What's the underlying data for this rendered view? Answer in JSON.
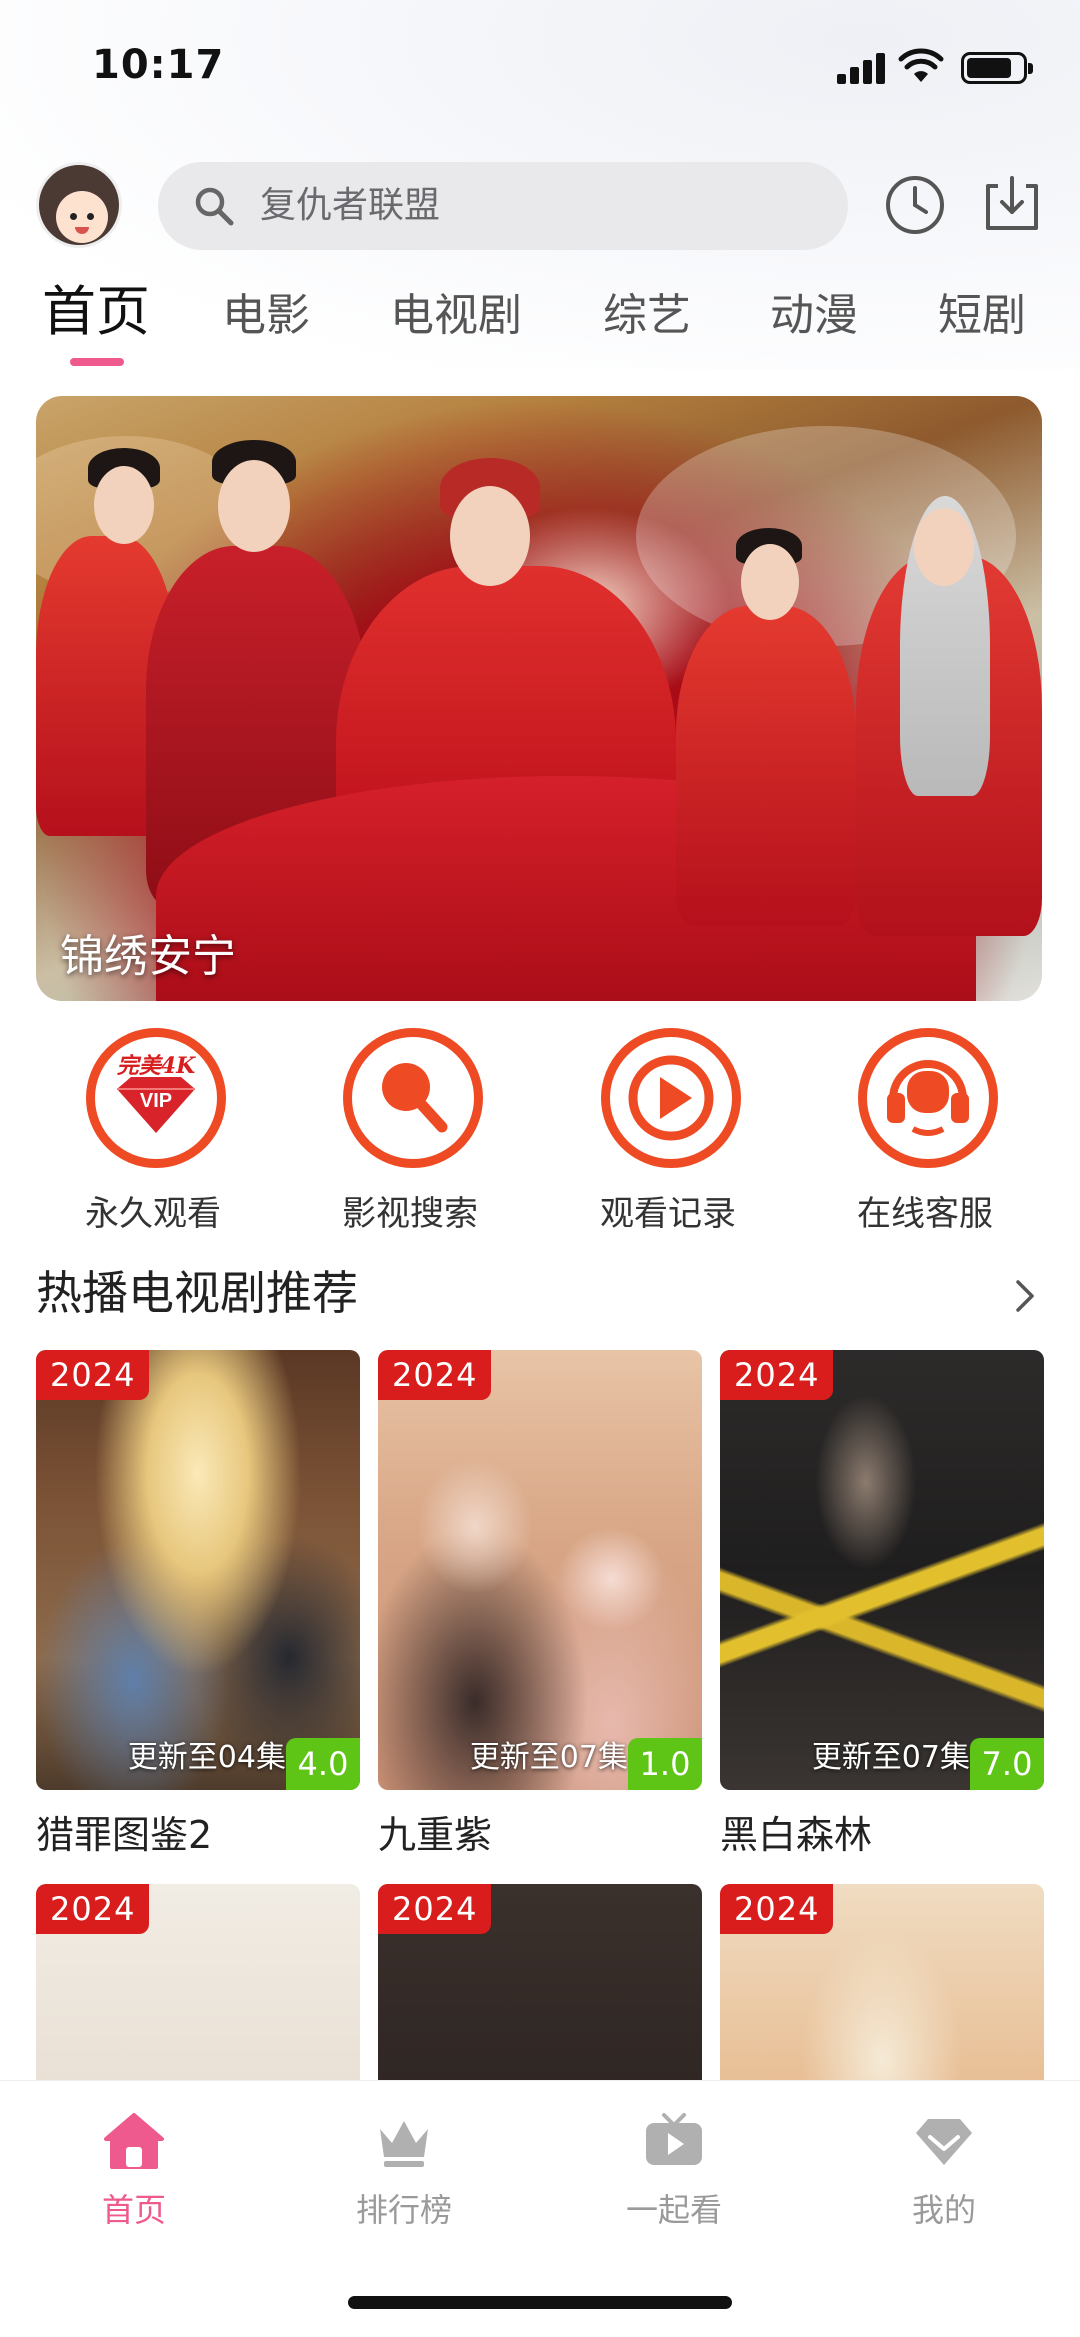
{
  "status_bar": {
    "time": "10:17"
  },
  "search": {
    "placeholder": "复仇者联盟"
  },
  "tabs": [
    {
      "label": "首页",
      "active": true
    },
    {
      "label": "电影"
    },
    {
      "label": "电视剧"
    },
    {
      "label": "综艺"
    },
    {
      "label": "动漫"
    },
    {
      "label": "短剧"
    }
  ],
  "banner": {
    "title": "锦绣安宁"
  },
  "quick_actions": [
    {
      "label": "永久观看",
      "icon": "vip-diamond-icon",
      "badge_text": "完美4K",
      "inner_text": "VIP"
    },
    {
      "label": "影视搜索",
      "icon": "magnifier-icon"
    },
    {
      "label": "观看记录",
      "icon": "play-history-icon"
    },
    {
      "label": "在线客服",
      "icon": "headset-icon"
    }
  ],
  "section": {
    "title": "热播电视剧推荐"
  },
  "cards_row1": [
    {
      "year": "2024",
      "episode": "更新至04集",
      "score": "4.0",
      "title": "猎罪图鉴2"
    },
    {
      "year": "2024",
      "episode": "更新至07集",
      "score": "1.0",
      "title": "九重紫"
    },
    {
      "year": "2024",
      "episode": "更新至07集",
      "score": "7.0",
      "title": "黑白森林"
    }
  ],
  "cards_row2": [
    {
      "year": "2024"
    },
    {
      "year": "2024"
    },
    {
      "year": "2024"
    }
  ],
  "bottom_nav": [
    {
      "label": "首页",
      "icon": "home-icon",
      "active": true
    },
    {
      "label": "排行榜",
      "icon": "crown-icon"
    },
    {
      "label": "一起看",
      "icon": "tv-play-icon"
    },
    {
      "label": "我的",
      "icon": "diamond-icon"
    }
  ],
  "colors": {
    "accent_pink": "#ef5a8e",
    "action_orange": "#ee4b24",
    "year_badge": "#d91c1c",
    "score_green": "#5ec416"
  }
}
